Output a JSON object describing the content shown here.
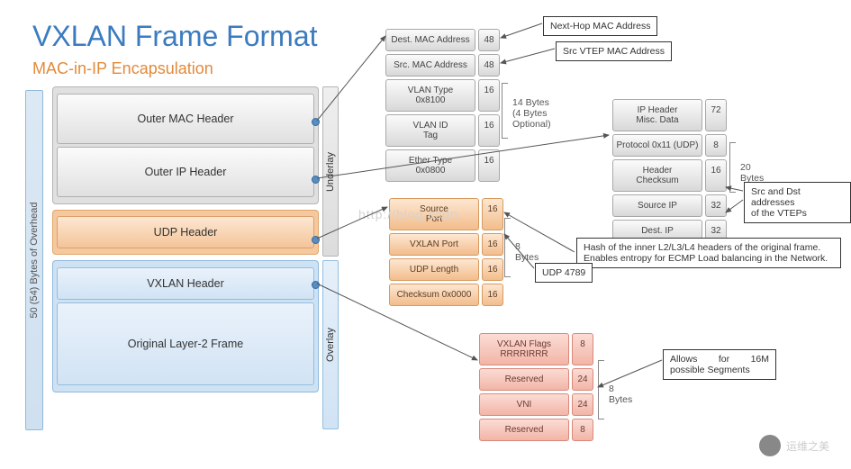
{
  "title": "VXLAN Frame Format",
  "subtitle": "MAC-in-IP Encapsulation",
  "overhead_label": "50 (54) Bytes of Overhead",
  "side": {
    "underlay": "Underlay",
    "overlay": "Overlay"
  },
  "stack": {
    "outer_mac": "Outer MAC Header",
    "outer_ip": "Outer IP Header",
    "udp": "UDP Header",
    "vxlan": "VXLAN Header",
    "orig": "Original Layer-2 Frame"
  },
  "mac_fields": {
    "rows": [
      {
        "name": "Dest. MAC Address",
        "bits": "48"
      },
      {
        "name": "Src. MAC  Address",
        "bits": "48"
      },
      {
        "name": "VLAN Type\n0x8100",
        "bits": "16"
      },
      {
        "name": "VLAN ID\nTag",
        "bits": "16"
      },
      {
        "name": "Ether Type\n0x0800",
        "bits": "16"
      }
    ],
    "size": "14 Bytes\n(4 Bytes Optional)"
  },
  "ip_fields": {
    "rows": [
      {
        "name": "IP Header\nMisc. Data",
        "bits": "72"
      },
      {
        "name": "Protocol 0x11 (UDP)",
        "bits": "8"
      },
      {
        "name": "Header\nChecksum",
        "bits": "16"
      },
      {
        "name": "Source IP",
        "bits": "32"
      },
      {
        "name": "Dest. IP",
        "bits": "32"
      }
    ],
    "size": "20 Bytes"
  },
  "udp_fields": {
    "rows": [
      {
        "name": "Source\nPort",
        "bits": "16"
      },
      {
        "name": "VXLAN Port",
        "bits": "16"
      },
      {
        "name": "UDP Length",
        "bits": "16"
      },
      {
        "name": "Checksum 0x0000",
        "bits": "16"
      }
    ],
    "size": "8 Bytes"
  },
  "vxlan_fields": {
    "rows": [
      {
        "name": "VXLAN Flags RRRRIRRR",
        "bits": "8"
      },
      {
        "name": "Reserved",
        "bits": "24"
      },
      {
        "name": "VNI",
        "bits": "24"
      },
      {
        "name": "Reserved",
        "bits": "8"
      }
    ],
    "size": "8 Bytes"
  },
  "ann": {
    "next_hop": "Next-Hop MAC Address",
    "src_vtep_mac": "Src VTEP MAC Address",
    "vteps": "Src and Dst addresses\nof the VTEPs",
    "hash": "Hash of the inner L2/L3/L4 headers of the original frame.\nEnables entropy for ECMP Load balancing in the Network.",
    "udp_port": "UDP 4789",
    "segments": "Allows for 16M possible Segments"
  },
  "watermark_text": "运维之美",
  "faint": "http://blog.csdn"
}
